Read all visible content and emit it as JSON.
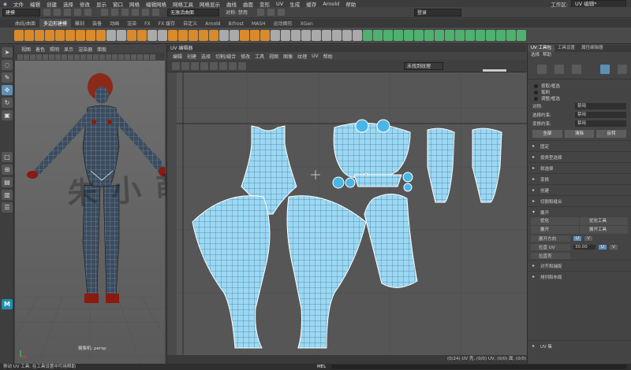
{
  "menubar": {
    "items": [
      "文件",
      "编辑",
      "创建",
      "选择",
      "修改",
      "显示",
      "窗口",
      "网格",
      "编辑网格",
      "网格工具",
      "网格显示",
      "曲线",
      "曲面",
      "变形",
      "UV",
      "生成",
      "缓存",
      "Arnold",
      "帮助"
    ],
    "workspace_label": "工作区:",
    "workspace_value": "UV 编辑*"
  },
  "statusline": {
    "mode": "建模",
    "target": "无激活曲面",
    "symmetry": "对称: 禁用",
    "user": "登录"
  },
  "shelf_tabs": [
    "曲线/曲面",
    "多边形建模",
    "雕刻",
    "装备",
    "动画",
    "渲染",
    "FX",
    "FX 缓存",
    "自定义",
    "Arnold",
    "Bifrost",
    "MASH",
    "运动图形",
    "XGen"
  ],
  "shelf_active": "多边形建模",
  "viewport": {
    "menu": [
      "视图",
      "着色",
      "照明",
      "显示",
      "渲染器",
      "面板"
    ],
    "camera_label": "persp",
    "camera_prefix": "摄像机:"
  },
  "uv_editor": {
    "title": "UV 编辑器",
    "menu": [
      "编辑",
      "创建",
      "选择",
      "切割/缝合",
      "修改",
      "工具",
      "视图",
      "图像",
      "纹理",
      "UV",
      "帮助"
    ],
    "texture_field": "未找到纹理",
    "status": "(0/24) UV 壳, (0/0) UV, (0/0) 面, (0/0)"
  },
  "sidepanel": {
    "tabs": [
      "UV 工具包",
      "工具设置",
      "属性编辑器"
    ],
    "menu": [
      "选择",
      "帮助"
    ],
    "options": [
      "按取/框选",
      "笔刷",
      "调整/框选"
    ],
    "symmetry_label": "对称:",
    "symmetry_value": "禁用",
    "select_by_label": "选择约束:",
    "select_by_value": "禁用",
    "transform_label": "变换约束:",
    "transform_value": "禁用",
    "buttons": [
      "全部",
      "清除",
      "反转"
    ],
    "sections_top": [
      "固定",
      "按类型选择",
      "软选择",
      "变换",
      "创建",
      "切割和缝合"
    ],
    "unfold_section": "展开",
    "unfold_tools": [
      "优化",
      "优化工具",
      "展开",
      "展开工具"
    ],
    "unfold_dir_label": "展开方向",
    "unfold_u": "U",
    "unfold_v": "V",
    "straighten_uv": "拉直 UV",
    "straighten_value": "30.00",
    "straighten_shell": "拉直壳",
    "sections_bottom": [
      "对齐和捕捉",
      "排列和布局"
    ],
    "uv_set_section": "UV 集"
  },
  "bottom": {
    "help_text": "移动 UV 工具: 在工具设置中可用帮助",
    "mel_label": "MEL"
  },
  "watermark": "朱小萌学习交流",
  "colors": {
    "accent": "#5d8fb5",
    "uv_line": "#8ad6ff",
    "mesh_select": "#5bc4ff",
    "mesh_red": "#8b1a10"
  }
}
